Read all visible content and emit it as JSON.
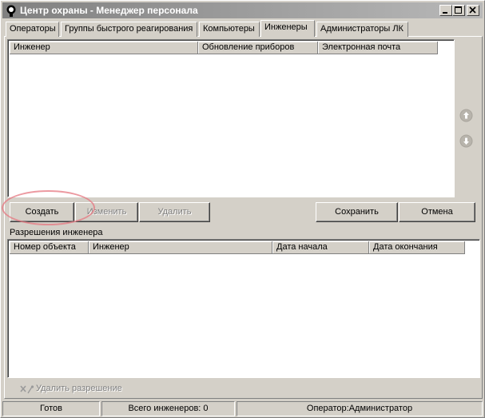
{
  "window": {
    "title": "Центр охраны - Менеджер персонала"
  },
  "tabs": [
    {
      "label": "Операторы"
    },
    {
      "label": "Группы быстрого реагирования"
    },
    {
      "label": "Компьютеры"
    },
    {
      "label": "Инженеры",
      "active": true
    },
    {
      "label": "Администраторы ЛК"
    }
  ],
  "engineers_table": {
    "columns": [
      "Инженер",
      "Обновление приборов",
      "Электронная почта"
    ],
    "rows": []
  },
  "buttons": {
    "create": "Создать",
    "edit": "Изменить",
    "delete": "Удалить",
    "save": "Сохранить",
    "cancel": "Отмена"
  },
  "permissions": {
    "title": "Разрешения инженера",
    "columns": [
      "Номер объекта",
      "Инженер",
      "Дата начала",
      "Дата окончания"
    ],
    "rows": [],
    "delete_permission": "Удалить разрешение"
  },
  "statusbar": {
    "state": "Готов",
    "total": "Всего инженеров: 0",
    "operator": "Оператор:Администратор"
  },
  "colors": {
    "face": "#d4d0c8",
    "titlebar": "#808080",
    "highlight_oval": "#e67882"
  }
}
